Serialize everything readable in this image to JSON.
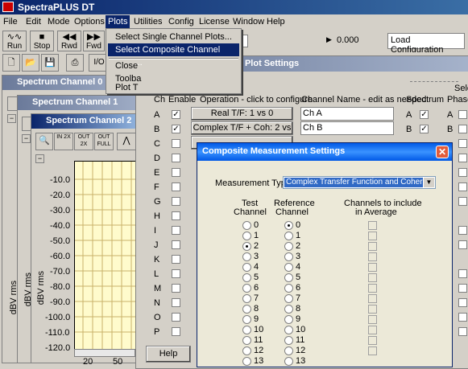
{
  "app": {
    "title": "SpectraPLUS DT"
  },
  "menubar": [
    "File",
    "Edit",
    "Mode",
    "Options",
    "Plots",
    "Utilities",
    "Config",
    "License",
    "Window",
    "Help"
  ],
  "plots_menu": [
    "Select Single Channel Plots...",
    "Select Composite Channel Plots...",
    "Close",
    "Toolba",
    "Plot T"
  ],
  "toolbar": {
    "buttons": [
      "Run",
      "Stop",
      "Rwd",
      "Fwd"
    ],
    "value_display": "0.000",
    "load_config": "Load Configuration",
    "io_label": "I/O"
  },
  "child_windows": [
    "Spectrum Channel 0",
    "Spectrum Channel 1",
    "Spectrum Channel 2"
  ],
  "zoom_buttons": [
    "IN 2X",
    "OUT 2X",
    "OUT FULL"
  ],
  "plot": {
    "ylabel": "dBV rms",
    "yticks": [
      "-10.0",
      "-20.0",
      "-30.0",
      "-40.0",
      "-50.0",
      "-60.0",
      "-70.0",
      "-80.0",
      "-90.0",
      "-100.0",
      "-110.0",
      "-120.0"
    ],
    "xticks": [
      "20",
      "50"
    ]
  },
  "composite_dialog": {
    "title": "Composite Channel and Plot Settings",
    "headers": {
      "ch": "Ch",
      "enable": "Enable",
      "operation": "Operation - click to configure",
      "name": "Channel Name - edit as needed",
      "spectrum": "Spectrum",
      "phase": "Phase",
      "select": "Selec"
    },
    "channels": [
      "A",
      "B",
      "C",
      "D",
      "E",
      "F",
      "G",
      "H",
      "I",
      "J",
      "K",
      "L",
      "M",
      "N",
      "O",
      "P"
    ],
    "ops": [
      "Real T/F: 1 vs 0",
      "Complex T/F + Coh: 2 vs 0"
    ],
    "names": [
      "Ch A",
      "Ch B"
    ],
    "help": "Help"
  },
  "measurement_dialog": {
    "title": "Composite Measurement Settings",
    "type_label": "Measurement Type",
    "type_value": "Complex Transfer Function and Coherence",
    "test_channel_label": [
      "Test",
      "Channel"
    ],
    "ref_channel_label": [
      "Reference",
      "Channel"
    ],
    "avg_label": [
      "Channels to include",
      "in Average"
    ],
    "options": [
      "0",
      "1",
      "2",
      "3",
      "4",
      "5",
      "6",
      "7",
      "8",
      "9",
      "10",
      "11",
      "12",
      "13"
    ],
    "test_selected": "2",
    "ref_selected": "0"
  }
}
